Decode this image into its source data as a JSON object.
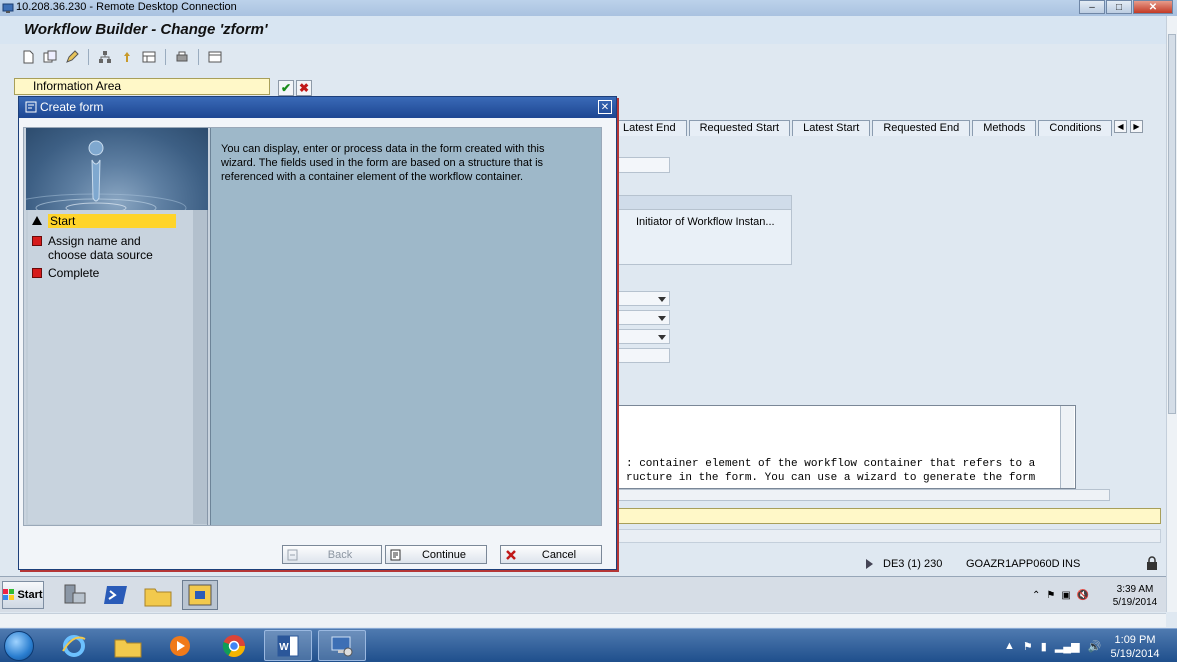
{
  "rdp": {
    "title": "10.208.36.230 - Remote Desktop Connection",
    "minimize": "–",
    "maximize": "□",
    "close": "✕"
  },
  "sap": {
    "title": "Workflow Builder - Change 'zform'",
    "info_area": "Information Area",
    "tabs": [
      "Latest End",
      "Requested Start",
      "Latest Start",
      "Requested End",
      "Methods",
      "Conditions"
    ],
    "initiator_text": "Initiator of Workflow Instan...",
    "editor_lines": [
      ": container element of the workflow container that refers to a",
      "ructure in the form. You can use a wizard to generate the form"
    ],
    "status": {
      "system": "DE3 (1) 230",
      "server": "GOAZR1APP060D",
      "mode": "INS"
    }
  },
  "dialog": {
    "title": "Create form",
    "close": "✕",
    "steps": [
      {
        "label": "Start",
        "state": "active"
      },
      {
        "label": "Assign name and choose data source",
        "state": "pending"
      },
      {
        "label": "Complete",
        "state": "pending"
      }
    ],
    "description": "You can display, enter or process data in the form created with this wizard. The fields used in the form are based on a structure that is referenced with a container element of the workflow container.",
    "buttons": {
      "back": "Back",
      "continue": "Continue",
      "cancel": "Cancel"
    }
  },
  "inner_taskbar": {
    "start": "Start",
    "time": "3:39 AM",
    "date": "5/19/2014"
  },
  "win_taskbar": {
    "time": "1:09 PM",
    "date": "5/19/2014"
  },
  "colors": {
    "dialog_title": "#1d4692",
    "active_step": "#ffd42a",
    "info_field": "#fff8c8",
    "right_panel": "#9eb8c9"
  }
}
